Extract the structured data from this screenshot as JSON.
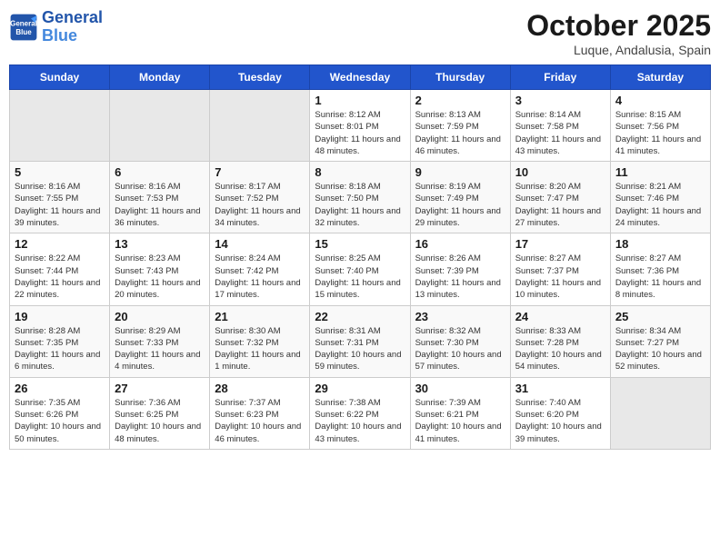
{
  "header": {
    "logo_line1": "General",
    "logo_line2": "Blue",
    "month": "October 2025",
    "location": "Luque, Andalusia, Spain"
  },
  "days_of_week": [
    "Sunday",
    "Monday",
    "Tuesday",
    "Wednesday",
    "Thursday",
    "Friday",
    "Saturday"
  ],
  "weeks": [
    [
      {
        "day": "",
        "empty": true
      },
      {
        "day": "",
        "empty": true
      },
      {
        "day": "",
        "empty": true
      },
      {
        "day": "1",
        "sunrise": "8:12 AM",
        "sunset": "8:01 PM",
        "daylight": "11 hours and 48 minutes."
      },
      {
        "day": "2",
        "sunrise": "8:13 AM",
        "sunset": "7:59 PM",
        "daylight": "11 hours and 46 minutes."
      },
      {
        "day": "3",
        "sunrise": "8:14 AM",
        "sunset": "7:58 PM",
        "daylight": "11 hours and 43 minutes."
      },
      {
        "day": "4",
        "sunrise": "8:15 AM",
        "sunset": "7:56 PM",
        "daylight": "11 hours and 41 minutes."
      }
    ],
    [
      {
        "day": "5",
        "sunrise": "8:16 AM",
        "sunset": "7:55 PM",
        "daylight": "11 hours and 39 minutes."
      },
      {
        "day": "6",
        "sunrise": "8:16 AM",
        "sunset": "7:53 PM",
        "daylight": "11 hours and 36 minutes."
      },
      {
        "day": "7",
        "sunrise": "8:17 AM",
        "sunset": "7:52 PM",
        "daylight": "11 hours and 34 minutes."
      },
      {
        "day": "8",
        "sunrise": "8:18 AM",
        "sunset": "7:50 PM",
        "daylight": "11 hours and 32 minutes."
      },
      {
        "day": "9",
        "sunrise": "8:19 AM",
        "sunset": "7:49 PM",
        "daylight": "11 hours and 29 minutes."
      },
      {
        "day": "10",
        "sunrise": "8:20 AM",
        "sunset": "7:47 PM",
        "daylight": "11 hours and 27 minutes."
      },
      {
        "day": "11",
        "sunrise": "8:21 AM",
        "sunset": "7:46 PM",
        "daylight": "11 hours and 24 minutes."
      }
    ],
    [
      {
        "day": "12",
        "sunrise": "8:22 AM",
        "sunset": "7:44 PM",
        "daylight": "11 hours and 22 minutes."
      },
      {
        "day": "13",
        "sunrise": "8:23 AM",
        "sunset": "7:43 PM",
        "daylight": "11 hours and 20 minutes."
      },
      {
        "day": "14",
        "sunrise": "8:24 AM",
        "sunset": "7:42 PM",
        "daylight": "11 hours and 17 minutes."
      },
      {
        "day": "15",
        "sunrise": "8:25 AM",
        "sunset": "7:40 PM",
        "daylight": "11 hours and 15 minutes."
      },
      {
        "day": "16",
        "sunrise": "8:26 AM",
        "sunset": "7:39 PM",
        "daylight": "11 hours and 13 minutes."
      },
      {
        "day": "17",
        "sunrise": "8:27 AM",
        "sunset": "7:37 PM",
        "daylight": "11 hours and 10 minutes."
      },
      {
        "day": "18",
        "sunrise": "8:27 AM",
        "sunset": "7:36 PM",
        "daylight": "11 hours and 8 minutes."
      }
    ],
    [
      {
        "day": "19",
        "sunrise": "8:28 AM",
        "sunset": "7:35 PM",
        "daylight": "11 hours and 6 minutes."
      },
      {
        "day": "20",
        "sunrise": "8:29 AM",
        "sunset": "7:33 PM",
        "daylight": "11 hours and 4 minutes."
      },
      {
        "day": "21",
        "sunrise": "8:30 AM",
        "sunset": "7:32 PM",
        "daylight": "11 hours and 1 minute."
      },
      {
        "day": "22",
        "sunrise": "8:31 AM",
        "sunset": "7:31 PM",
        "daylight": "10 hours and 59 minutes."
      },
      {
        "day": "23",
        "sunrise": "8:32 AM",
        "sunset": "7:30 PM",
        "daylight": "10 hours and 57 minutes."
      },
      {
        "day": "24",
        "sunrise": "8:33 AM",
        "sunset": "7:28 PM",
        "daylight": "10 hours and 54 minutes."
      },
      {
        "day": "25",
        "sunrise": "8:34 AM",
        "sunset": "7:27 PM",
        "daylight": "10 hours and 52 minutes."
      }
    ],
    [
      {
        "day": "26",
        "sunrise": "7:35 AM",
        "sunset": "6:26 PM",
        "daylight": "10 hours and 50 minutes."
      },
      {
        "day": "27",
        "sunrise": "7:36 AM",
        "sunset": "6:25 PM",
        "daylight": "10 hours and 48 minutes."
      },
      {
        "day": "28",
        "sunrise": "7:37 AM",
        "sunset": "6:23 PM",
        "daylight": "10 hours and 46 minutes."
      },
      {
        "day": "29",
        "sunrise": "7:38 AM",
        "sunset": "6:22 PM",
        "daylight": "10 hours and 43 minutes."
      },
      {
        "day": "30",
        "sunrise": "7:39 AM",
        "sunset": "6:21 PM",
        "daylight": "10 hours and 41 minutes."
      },
      {
        "day": "31",
        "sunrise": "7:40 AM",
        "sunset": "6:20 PM",
        "daylight": "10 hours and 39 minutes."
      },
      {
        "day": "",
        "empty": true
      }
    ]
  ],
  "labels": {
    "sunrise_label": "Sunrise:",
    "sunset_label": "Sunset:",
    "daylight_label": "Daylight:"
  }
}
